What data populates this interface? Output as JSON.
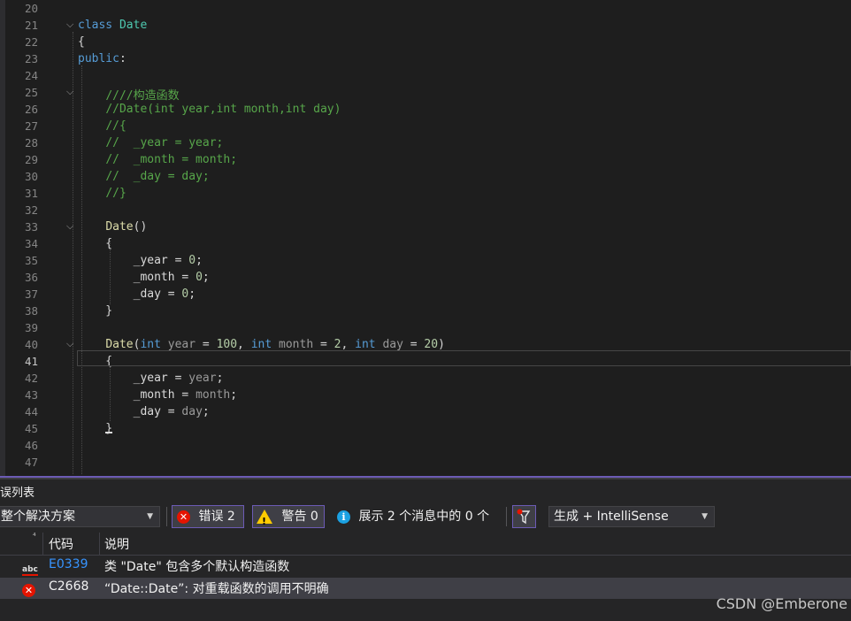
{
  "editor": {
    "current_line": 41,
    "lines": [
      {
        "n": 20,
        "fold": "",
        "tokens": []
      },
      {
        "n": 21,
        "fold": "v",
        "tokens": [
          [
            "kw",
            "class"
          ],
          [
            "",
            " "
          ],
          [
            "type",
            "Date"
          ]
        ]
      },
      {
        "n": 22,
        "fold": "",
        "tokens": [
          [
            "",
            "{"
          ]
        ]
      },
      {
        "n": 23,
        "fold": "",
        "tokens": [
          [
            "kw",
            "public"
          ],
          [
            "",
            ":"
          ]
        ]
      },
      {
        "n": 24,
        "fold": "",
        "tokens": []
      },
      {
        "n": 25,
        "fold": "v",
        "tokens": [
          [
            "",
            "    "
          ],
          [
            "cm",
            "////构造函数"
          ]
        ]
      },
      {
        "n": 26,
        "fold": "",
        "tokens": [
          [
            "",
            "    "
          ],
          [
            "cm",
            "//Date(int year,int month,int day)"
          ]
        ]
      },
      {
        "n": 27,
        "fold": "",
        "tokens": [
          [
            "",
            "    "
          ],
          [
            "cm",
            "//{"
          ]
        ]
      },
      {
        "n": 28,
        "fold": "",
        "tokens": [
          [
            "",
            "    "
          ],
          [
            "cm",
            "//  _year = year;"
          ]
        ]
      },
      {
        "n": 29,
        "fold": "",
        "tokens": [
          [
            "",
            "    "
          ],
          [
            "cm",
            "//  _month = month;"
          ]
        ]
      },
      {
        "n": 30,
        "fold": "",
        "tokens": [
          [
            "",
            "    "
          ],
          [
            "cm",
            "//  _day = day;"
          ]
        ]
      },
      {
        "n": 31,
        "fold": "",
        "tokens": [
          [
            "",
            "    "
          ],
          [
            "cm",
            "//}"
          ]
        ]
      },
      {
        "n": 32,
        "fold": "",
        "tokens": []
      },
      {
        "n": 33,
        "fold": "v",
        "tokens": [
          [
            "",
            "    "
          ],
          [
            "fn",
            "Date"
          ],
          [
            "",
            "()"
          ]
        ]
      },
      {
        "n": 34,
        "fold": "",
        "tokens": [
          [
            "",
            "    {"
          ]
        ]
      },
      {
        "n": 35,
        "fold": "",
        "tokens": [
          [
            "",
            "        "
          ],
          [
            "var",
            "_year"
          ],
          [
            "",
            " = "
          ],
          [
            "num",
            "0"
          ],
          [
            "",
            ";"
          ]
        ]
      },
      {
        "n": 36,
        "fold": "",
        "tokens": [
          [
            "",
            "        "
          ],
          [
            "var",
            "_month"
          ],
          [
            "",
            " = "
          ],
          [
            "num",
            "0"
          ],
          [
            "",
            ";"
          ]
        ]
      },
      {
        "n": 37,
        "fold": "",
        "tokens": [
          [
            "",
            "        "
          ],
          [
            "var",
            "_day"
          ],
          [
            "",
            " = "
          ],
          [
            "num",
            "0"
          ],
          [
            "",
            ";"
          ]
        ]
      },
      {
        "n": 38,
        "fold": "",
        "tokens": [
          [
            "",
            "    }"
          ]
        ]
      },
      {
        "n": 39,
        "fold": "",
        "tokens": []
      },
      {
        "n": 40,
        "fold": "v",
        "tokens": [
          [
            "",
            "    "
          ],
          [
            "fn",
            "Date"
          ],
          [
            "",
            "("
          ],
          [
            "kw",
            "int"
          ],
          [
            "",
            " "
          ],
          [
            "dim",
            "year"
          ],
          [
            "",
            " = "
          ],
          [
            "num",
            "100"
          ],
          [
            "",
            ", "
          ],
          [
            "kw",
            "int"
          ],
          [
            "",
            " "
          ],
          [
            "dim",
            "month"
          ],
          [
            "",
            " = "
          ],
          [
            "num",
            "2"
          ],
          [
            "",
            ", "
          ],
          [
            "kw",
            "int"
          ],
          [
            "",
            " "
          ],
          [
            "dim",
            "day"
          ],
          [
            "",
            " = "
          ],
          [
            "num",
            "20"
          ],
          [
            "",
            ")"
          ]
        ]
      },
      {
        "n": 41,
        "fold": "",
        "tokens": [
          [
            "",
            "    {"
          ]
        ]
      },
      {
        "n": 42,
        "fold": "",
        "tokens": [
          [
            "",
            "        "
          ],
          [
            "var",
            "_year"
          ],
          [
            "",
            " = "
          ],
          [
            "dim",
            "year"
          ],
          [
            "",
            ";"
          ]
        ]
      },
      {
        "n": 43,
        "fold": "",
        "tokens": [
          [
            "",
            "        "
          ],
          [
            "var",
            "_month"
          ],
          [
            "",
            " = "
          ],
          [
            "dim",
            "month"
          ],
          [
            "",
            ";"
          ]
        ]
      },
      {
        "n": 44,
        "fold": "",
        "tokens": [
          [
            "",
            "        "
          ],
          [
            "var",
            "_day"
          ],
          [
            "",
            " = "
          ],
          [
            "dim",
            "day"
          ],
          [
            "",
            ";"
          ]
        ]
      },
      {
        "n": 45,
        "fold": "",
        "tokens": [
          [
            "",
            "    }"
          ]
        ]
      },
      {
        "n": 46,
        "fold": "",
        "tokens": []
      },
      {
        "n": 47,
        "fold": "",
        "tokens": []
      }
    ]
  },
  "error_list": {
    "title": "错误列表",
    "scope_selected": "整个解决方案",
    "errors_label": "错误 2",
    "warnings_label": "警告 0",
    "messages_label": "展示 2 个消息中的 0 个",
    "build_filter_selected": "生成 + IntelliSense",
    "columns": {
      "code": "代码",
      "description": "说明"
    },
    "rows": [
      {
        "icon": "intellisense-abc-icon",
        "code": "E0339",
        "description": "类 \"Date\" 包含多个默认构造函数"
      },
      {
        "icon": "error-icon",
        "code": "C2668",
        "description": "“Date::Date”: 对重载函数的调用不明确"
      }
    ]
  },
  "watermark": "CSDN @Emberone",
  "colors": {
    "keyword": "#569cd6",
    "type": "#4ec9b0",
    "function": "#dcdcaa",
    "comment": "#57a64a",
    "number": "#b5cea8",
    "accent": "#6c5bb5",
    "error": "#e51400",
    "warning": "#ffcc00",
    "info": "#1ba1e2"
  }
}
